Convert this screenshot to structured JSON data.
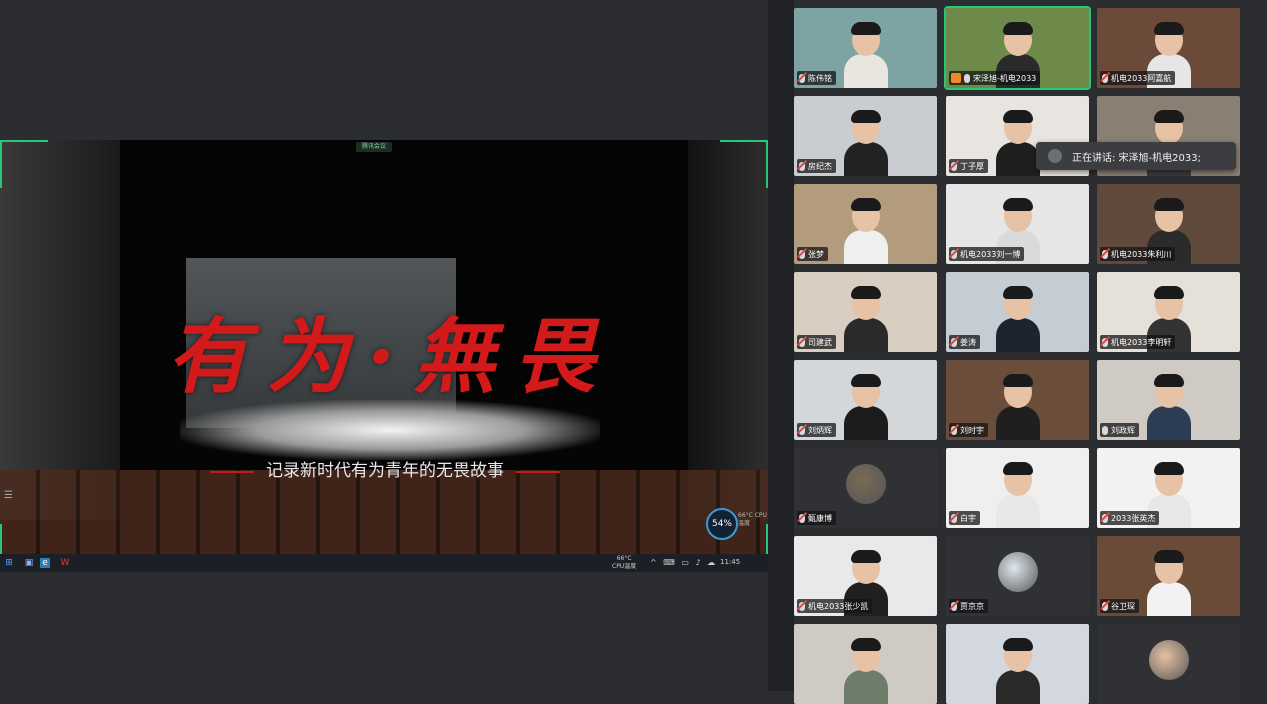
{
  "shared_screen": {
    "indicator": "腾讯会议",
    "headline": "有为·無畏",
    "subtitle": "记录新时代有为青年的无畏故事",
    "cpu_percent": "54%",
    "cpu_caption": "66°C CPU温度",
    "taskbar_temp_top": "66°C",
    "taskbar_temp_bottom": "CPU温度",
    "taskbar_clock": "11:45"
  },
  "speaking_tooltip": "正在讲话: 宋泽旭-机电2033;",
  "participants": [
    {
      "name": "陈伟铭",
      "active": false,
      "muted": true,
      "bg": "#7ea3a3",
      "shirt": "#e9e6e0"
    },
    {
      "name": "宋泽旭-机电2033",
      "active": true,
      "muted": false,
      "host": true,
      "bg": "#6e8a4a",
      "shirt": "#2a2a2a"
    },
    {
      "name": "机电2033阿嘉航",
      "active": false,
      "muted": true,
      "bg": "#6b4a3a",
      "shirt": "#e6e6e6"
    },
    {
      "name": "房纪杰",
      "active": false,
      "muted": true,
      "bg": "#c9ccd0",
      "shirt": "#222"
    },
    {
      "name": "丁子厚",
      "active": false,
      "muted": true,
      "bg": "#e8e4e0",
      "shirt": "#1f1f1f"
    },
    {
      "name": "",
      "active": false,
      "muted": true,
      "bg": "#8a7f73",
      "shirt": "#3a3a3a"
    },
    {
      "name": "张梦",
      "active": false,
      "muted": true,
      "bg": "#b39b7e",
      "shirt": "#efefef"
    },
    {
      "name": "机电2033刘一博",
      "active": false,
      "muted": true,
      "bg": "#e6e6e6",
      "shirt": "#dadada"
    },
    {
      "name": "机电2033朱利川",
      "active": false,
      "muted": true,
      "bg": "#5f4a3c",
      "shirt": "#2b2b2b"
    },
    {
      "name": "司建武",
      "active": false,
      "muted": true,
      "bg": "#d8cfc2",
      "shirt": "#2a2a2a"
    },
    {
      "name": "姜涛",
      "active": false,
      "muted": true,
      "bg": "#c4cdd4",
      "shirt": "#1d2430"
    },
    {
      "name": "机电2033李明轩",
      "active": false,
      "muted": true,
      "bg": "#e5e0d8",
      "shirt": "#333"
    },
    {
      "name": "刘炳辉",
      "active": false,
      "muted": true,
      "bg": "#d4d7da",
      "shirt": "#1c1c1c"
    },
    {
      "name": "刘时宇",
      "active": false,
      "muted": true,
      "bg": "#6b4d3b",
      "shirt": "#1f1f1f"
    },
    {
      "name": "刘政辉",
      "active": false,
      "muted": false,
      "bg": "#cfcac3",
      "shirt": "#2c3d55"
    },
    {
      "name": "甄康博",
      "active": false,
      "muted": true,
      "avatar": true,
      "bg": "#2f3135",
      "shirt": "#7a6a55"
    },
    {
      "name": "白宇",
      "active": false,
      "muted": true,
      "bg": "#efefef",
      "shirt": "#e8e8e8"
    },
    {
      "name": "2033张英杰",
      "active": false,
      "muted": true,
      "bg": "#f2f2f2",
      "shirt": "#e7e7e7"
    },
    {
      "name": "机电2033张少凯",
      "active": false,
      "muted": true,
      "bg": "#e9e9e9",
      "shirt": "#202020"
    },
    {
      "name": "贾京京",
      "active": false,
      "muted": true,
      "avatar": true,
      "bg": "#2f3135",
      "shirt": "#dfe6ee"
    },
    {
      "name": "谷卫琛",
      "active": false,
      "muted": true,
      "bg": "#6a4b38",
      "shirt": "#f2f2f2"
    },
    {
      "name": "",
      "active": false,
      "muted": true,
      "bg": "#cfcbc4",
      "shirt": "#6e7c6a"
    },
    {
      "name": "",
      "active": false,
      "muted": true,
      "bg": "#d3d8de",
      "shirt": "#2a2a2a"
    },
    {
      "name": "",
      "active": false,
      "muted": true,
      "avatar": true,
      "bg": "#2f3135",
      "shirt": "#e6c2a4"
    }
  ]
}
